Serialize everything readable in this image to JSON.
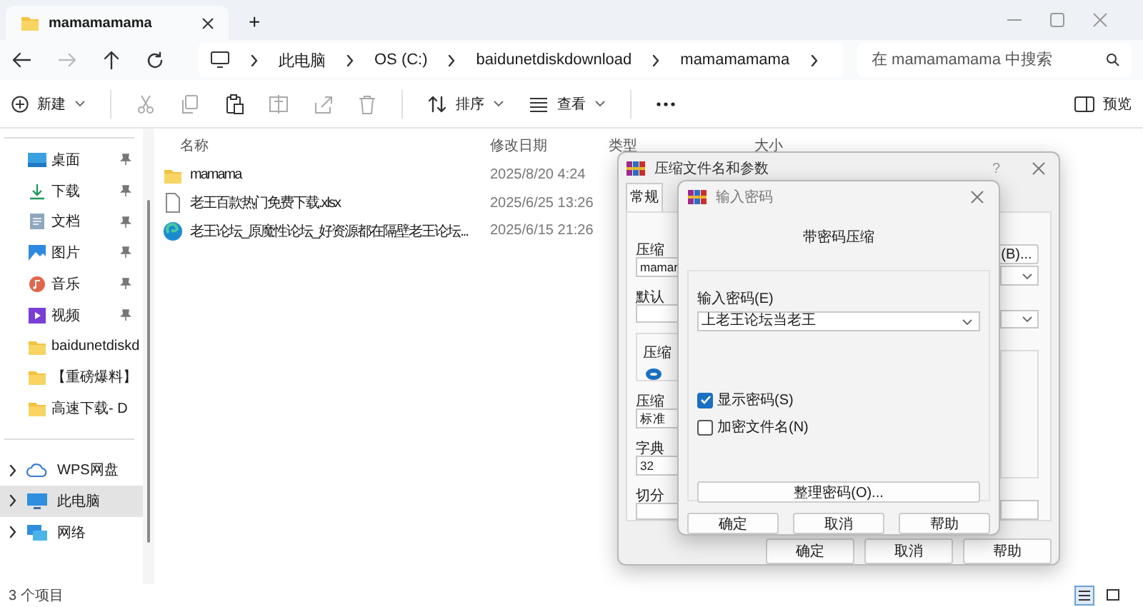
{
  "window": {
    "tab_title": "mamamamama",
    "new_tab": "+"
  },
  "nav": {
    "breadcrumb": [
      "此电脑",
      "OS (C:)",
      "baidunetdiskdownload",
      "mamamamama"
    ],
    "search": {
      "placeholder": "在 mamamamama 中搜索"
    }
  },
  "toolbar": {
    "new": "新建",
    "sort": "排序",
    "view": "查看",
    "preview": "预览"
  },
  "sidebar": {
    "quick_access": [
      {
        "label": "桌面",
        "kind": "desktop",
        "pinned": true
      },
      {
        "label": "下载",
        "kind": "download",
        "pinned": true
      },
      {
        "label": "文档",
        "kind": "documents",
        "pinned": true
      },
      {
        "label": "图片",
        "kind": "pictures",
        "pinned": true
      },
      {
        "label": "音乐",
        "kind": "music",
        "pinned": true
      },
      {
        "label": "视频",
        "kind": "videos",
        "pinned": true
      },
      {
        "label": "baidunetdiskd",
        "kind": "folder",
        "pinned": false
      },
      {
        "label": "【重磅爆料】",
        "kind": "folder",
        "pinned": false
      },
      {
        "label": "高速下载- D",
        "kind": "folder",
        "pinned": false
      }
    ],
    "places": [
      {
        "label": "WPS网盘",
        "kind": "cloud",
        "selected": false
      },
      {
        "label": "此电脑",
        "kind": "computer",
        "selected": true
      },
      {
        "label": "网络",
        "kind": "network",
        "selected": false
      }
    ]
  },
  "file_list": {
    "columns": [
      "名称",
      "修改日期",
      "类型",
      "大小"
    ],
    "rows": [
      {
        "kind": "folder",
        "name": "mamama",
        "date": "2025/8/20 4:24"
      },
      {
        "kind": "file",
        "name": "老王百款热门免费下载.xlsx",
        "date": "2025/6/25 13:26"
      },
      {
        "kind": "web",
        "name": "老王论坛_原魔性论坛_好资源都在隔壁老王论坛...",
        "date": "2025/6/15 21:26"
      }
    ]
  },
  "status_bar": "3 个项目",
  "view_modes": [
    {
      "kind": "details",
      "selected": true
    },
    {
      "kind": "tiles",
      "selected": false
    }
  ],
  "archive_dialog": {
    "title": "压缩文件名和参数",
    "help": "?",
    "tabs": [
      {
        "label": "常规",
        "selected": true
      }
    ],
    "archive_name_label": "压缩",
    "archive_name": "mamar",
    "browse_button": "(B)...",
    "profile_label": "默认",
    "format_label": "压缩",
    "format_radio_selected": true,
    "method_label": "压缩",
    "method": "标准",
    "dictionary_label": "字典",
    "dictionary": "32",
    "split_label": "切分",
    "buttons": [
      "确定",
      "取消",
      "帮助"
    ]
  },
  "password_dialog": {
    "title": "输入密码",
    "heading": "带密码压缩",
    "password_label": "输入密码(E)",
    "password": "上老王论坛当老王",
    "options": [
      {
        "label": "显示密码(S)",
        "checked": true
      },
      {
        "label": "加密文件名(N)",
        "checked": false
      }
    ],
    "organize_button": "整理密码(O)...",
    "buttons": [
      "确定",
      "取消",
      "帮助"
    ]
  }
}
